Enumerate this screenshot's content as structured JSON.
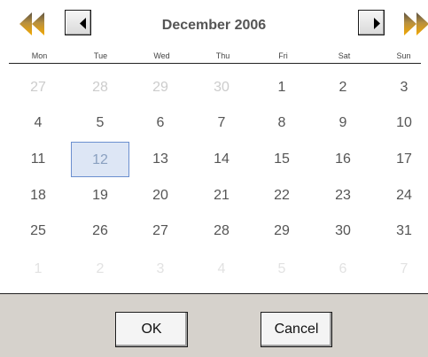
{
  "calendar": {
    "title": "December 2006",
    "weekdays": [
      "Mon",
      "Tue",
      "Wed",
      "Thu",
      "Fri",
      "Sat",
      "Sun"
    ],
    "weeks": [
      [
        {
          "d": "27",
          "t": "other"
        },
        {
          "d": "28",
          "t": "other"
        },
        {
          "d": "29",
          "t": "other"
        },
        {
          "d": "30",
          "t": "other"
        },
        {
          "d": "1",
          "t": "cur"
        },
        {
          "d": "2",
          "t": "cur"
        },
        {
          "d": "3",
          "t": "cur"
        }
      ],
      [
        {
          "d": "4",
          "t": "cur"
        },
        {
          "d": "5",
          "t": "cur"
        },
        {
          "d": "6",
          "t": "cur"
        },
        {
          "d": "7",
          "t": "cur"
        },
        {
          "d": "8",
          "t": "cur"
        },
        {
          "d": "9",
          "t": "cur"
        },
        {
          "d": "10",
          "t": "cur"
        }
      ],
      [
        {
          "d": "11",
          "t": "cur"
        },
        {
          "d": "12",
          "t": "sel"
        },
        {
          "d": "13",
          "t": "cur"
        },
        {
          "d": "14",
          "t": "cur"
        },
        {
          "d": "15",
          "t": "cur"
        },
        {
          "d": "16",
          "t": "cur"
        },
        {
          "d": "17",
          "t": "cur"
        }
      ],
      [
        {
          "d": "18",
          "t": "cur"
        },
        {
          "d": "19",
          "t": "cur"
        },
        {
          "d": "20",
          "t": "cur"
        },
        {
          "d": "21",
          "t": "cur"
        },
        {
          "d": "22",
          "t": "cur"
        },
        {
          "d": "23",
          "t": "cur"
        },
        {
          "d": "24",
          "t": "cur"
        }
      ],
      [
        {
          "d": "25",
          "t": "cur"
        },
        {
          "d": "26",
          "t": "cur"
        },
        {
          "d": "27",
          "t": "cur"
        },
        {
          "d": "28",
          "t": "cur"
        },
        {
          "d": "29",
          "t": "cur"
        },
        {
          "d": "30",
          "t": "cur"
        },
        {
          "d": "31",
          "t": "cur"
        }
      ],
      [
        {
          "d": "1",
          "t": "next"
        },
        {
          "d": "2",
          "t": "next"
        },
        {
          "d": "3",
          "t": "next"
        },
        {
          "d": "4",
          "t": "next"
        },
        {
          "d": "5",
          "t": "next"
        },
        {
          "d": "6",
          "t": "next"
        },
        {
          "d": "7",
          "t": "next"
        }
      ]
    ],
    "selected_day": "12"
  },
  "nav": {
    "prev_year_icon": "double-left-arrow-icon",
    "prev_month_icon": "left-triangle-icon",
    "next_month_icon": "right-triangle-icon",
    "next_year_icon": "double-right-arrow-icon"
  },
  "footer": {
    "ok_label": "OK",
    "cancel_label": "Cancel"
  },
  "colors": {
    "selected_fill": "#dde6f5",
    "selected_border": "#6b8fcf",
    "footer_bg": "#d6d2cc",
    "arrow_gold": "#f0a800",
    "arrow_dark": "#6a5a30"
  }
}
